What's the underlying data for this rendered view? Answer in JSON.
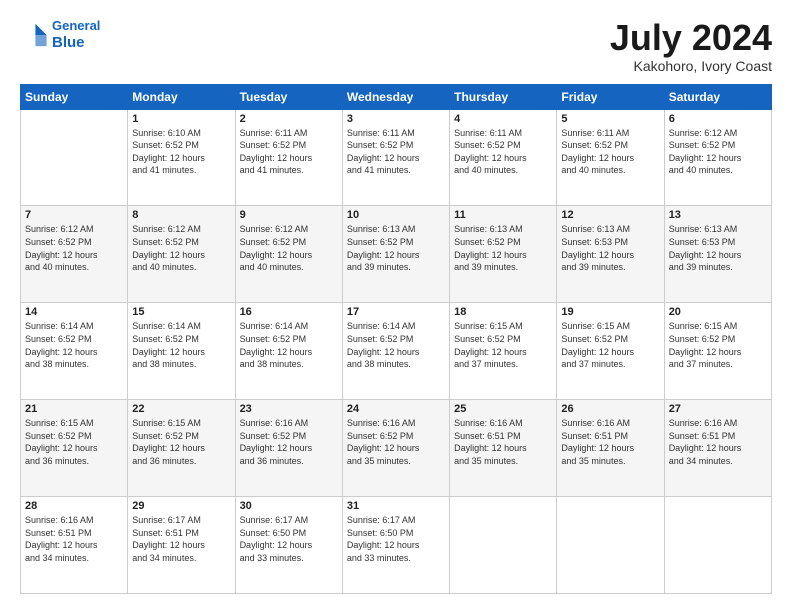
{
  "header": {
    "logo_line1": "General",
    "logo_line2": "Blue",
    "main_title": "July 2024",
    "subtitle": "Kakohoro, Ivory Coast"
  },
  "days_of_week": [
    "Sunday",
    "Monday",
    "Tuesday",
    "Wednesday",
    "Thursday",
    "Friday",
    "Saturday"
  ],
  "weeks": [
    [
      {
        "day": "",
        "info": ""
      },
      {
        "day": "1",
        "info": "Sunrise: 6:10 AM\nSunset: 6:52 PM\nDaylight: 12 hours\nand 41 minutes."
      },
      {
        "day": "2",
        "info": "Sunrise: 6:11 AM\nSunset: 6:52 PM\nDaylight: 12 hours\nand 41 minutes."
      },
      {
        "day": "3",
        "info": "Sunrise: 6:11 AM\nSunset: 6:52 PM\nDaylight: 12 hours\nand 41 minutes."
      },
      {
        "day": "4",
        "info": "Sunrise: 6:11 AM\nSunset: 6:52 PM\nDaylight: 12 hours\nand 40 minutes."
      },
      {
        "day": "5",
        "info": "Sunrise: 6:11 AM\nSunset: 6:52 PM\nDaylight: 12 hours\nand 40 minutes."
      },
      {
        "day": "6",
        "info": "Sunrise: 6:12 AM\nSunset: 6:52 PM\nDaylight: 12 hours\nand 40 minutes."
      }
    ],
    [
      {
        "day": "7",
        "info": "Sunrise: 6:12 AM\nSunset: 6:52 PM\nDaylight: 12 hours\nand 40 minutes."
      },
      {
        "day": "8",
        "info": "Sunrise: 6:12 AM\nSunset: 6:52 PM\nDaylight: 12 hours\nand 40 minutes."
      },
      {
        "day": "9",
        "info": "Sunrise: 6:12 AM\nSunset: 6:52 PM\nDaylight: 12 hours\nand 40 minutes."
      },
      {
        "day": "10",
        "info": "Sunrise: 6:13 AM\nSunset: 6:52 PM\nDaylight: 12 hours\nand 39 minutes."
      },
      {
        "day": "11",
        "info": "Sunrise: 6:13 AM\nSunset: 6:52 PM\nDaylight: 12 hours\nand 39 minutes."
      },
      {
        "day": "12",
        "info": "Sunrise: 6:13 AM\nSunset: 6:53 PM\nDaylight: 12 hours\nand 39 minutes."
      },
      {
        "day": "13",
        "info": "Sunrise: 6:13 AM\nSunset: 6:53 PM\nDaylight: 12 hours\nand 39 minutes."
      }
    ],
    [
      {
        "day": "14",
        "info": "Sunrise: 6:14 AM\nSunset: 6:52 PM\nDaylight: 12 hours\nand 38 minutes."
      },
      {
        "day": "15",
        "info": "Sunrise: 6:14 AM\nSunset: 6:52 PM\nDaylight: 12 hours\nand 38 minutes."
      },
      {
        "day": "16",
        "info": "Sunrise: 6:14 AM\nSunset: 6:52 PM\nDaylight: 12 hours\nand 38 minutes."
      },
      {
        "day": "17",
        "info": "Sunrise: 6:14 AM\nSunset: 6:52 PM\nDaylight: 12 hours\nand 38 minutes."
      },
      {
        "day": "18",
        "info": "Sunrise: 6:15 AM\nSunset: 6:52 PM\nDaylight: 12 hours\nand 37 minutes."
      },
      {
        "day": "19",
        "info": "Sunrise: 6:15 AM\nSunset: 6:52 PM\nDaylight: 12 hours\nand 37 minutes."
      },
      {
        "day": "20",
        "info": "Sunrise: 6:15 AM\nSunset: 6:52 PM\nDaylight: 12 hours\nand 37 minutes."
      }
    ],
    [
      {
        "day": "21",
        "info": "Sunrise: 6:15 AM\nSunset: 6:52 PM\nDaylight: 12 hours\nand 36 minutes."
      },
      {
        "day": "22",
        "info": "Sunrise: 6:15 AM\nSunset: 6:52 PM\nDaylight: 12 hours\nand 36 minutes."
      },
      {
        "day": "23",
        "info": "Sunrise: 6:16 AM\nSunset: 6:52 PM\nDaylight: 12 hours\nand 36 minutes."
      },
      {
        "day": "24",
        "info": "Sunrise: 6:16 AM\nSunset: 6:52 PM\nDaylight: 12 hours\nand 35 minutes."
      },
      {
        "day": "25",
        "info": "Sunrise: 6:16 AM\nSunset: 6:51 PM\nDaylight: 12 hours\nand 35 minutes."
      },
      {
        "day": "26",
        "info": "Sunrise: 6:16 AM\nSunset: 6:51 PM\nDaylight: 12 hours\nand 35 minutes."
      },
      {
        "day": "27",
        "info": "Sunrise: 6:16 AM\nSunset: 6:51 PM\nDaylight: 12 hours\nand 34 minutes."
      }
    ],
    [
      {
        "day": "28",
        "info": "Sunrise: 6:16 AM\nSunset: 6:51 PM\nDaylight: 12 hours\nand 34 minutes."
      },
      {
        "day": "29",
        "info": "Sunrise: 6:17 AM\nSunset: 6:51 PM\nDaylight: 12 hours\nand 34 minutes."
      },
      {
        "day": "30",
        "info": "Sunrise: 6:17 AM\nSunset: 6:50 PM\nDaylight: 12 hours\nand 33 minutes."
      },
      {
        "day": "31",
        "info": "Sunrise: 6:17 AM\nSunset: 6:50 PM\nDaylight: 12 hours\nand 33 minutes."
      },
      {
        "day": "",
        "info": ""
      },
      {
        "day": "",
        "info": ""
      },
      {
        "day": "",
        "info": ""
      }
    ]
  ]
}
